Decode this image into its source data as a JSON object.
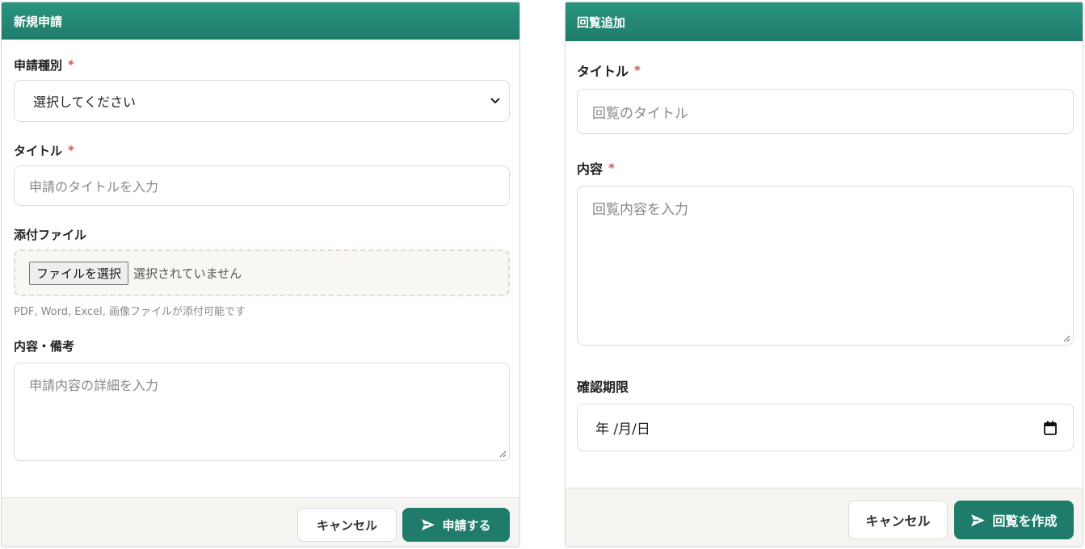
{
  "left_panel": {
    "title": "新規申請",
    "type_label": "申請種別",
    "type_select_value": "選択してください",
    "title_label": "タイトル",
    "title_placeholder": "申請のタイトルを入力",
    "attach_label": "添付ファイル",
    "file_button": "ファイルを選択",
    "file_status": "選択されていません",
    "file_hint": "PDF, Word, Excel, 画像ファイルが添付可能です",
    "notes_label": "内容・備考",
    "notes_placeholder": "申請内容の詳細を入力",
    "cancel_label": "キャンセル",
    "submit_label": "申請する",
    "required_mark": "*"
  },
  "right_panel": {
    "title": "回覧追加",
    "title_label": "タイトル",
    "title_placeholder": "回覧のタイトル",
    "content_label": "内容",
    "content_placeholder": "回覧内容を入力",
    "deadline_label": "確認期限",
    "deadline_value": "年 /月/日",
    "cancel_label": "キャンセル",
    "submit_label": "回覧を作成",
    "required_mark": "*"
  },
  "icons": {
    "send": "send-icon",
    "chevron": "chevron-down-icon",
    "calendar": "calendar-icon",
    "resize": "resize-grip-icon"
  },
  "colors": {
    "header_green": "#1f7c6b",
    "required_red": "#d9534f"
  }
}
